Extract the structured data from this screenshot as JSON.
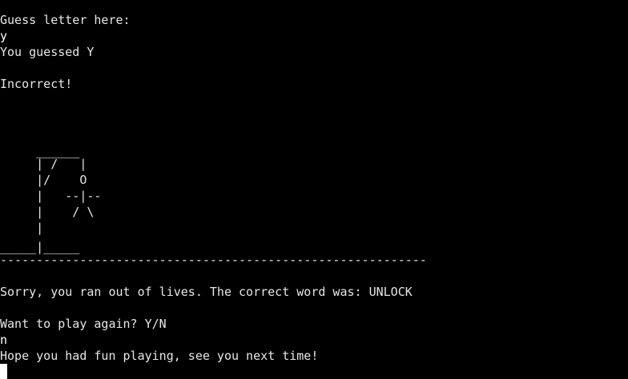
{
  "terminal": {
    "prompt_guess": "Guess letter here:",
    "input_guess": "y",
    "you_guessed": "You guessed Y",
    "result": "Incorrect!",
    "gallows": [
      "     ______",
      "     | /   |",
      "     |/    O",
      "     |   --|--",
      "     |    / \\",
      "     |",
      "_____|_____"
    ],
    "divider": "-----------------------------------------------------------",
    "lose_message": "Sorry, you ran out of lives. The correct word was: UNLOCK",
    "play_again_prompt": "Want to play again? Y/N",
    "input_play_again": "n",
    "goodbye": "Hope you had fun playing, see you next time!"
  }
}
